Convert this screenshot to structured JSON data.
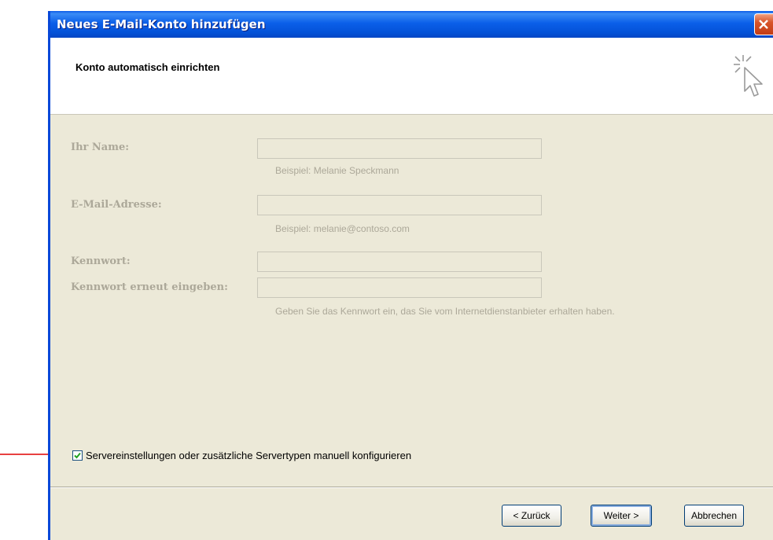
{
  "window": {
    "title": "Neues E-Mail-Konto hinzufügen"
  },
  "header": {
    "title": "Konto automatisch einrichten"
  },
  "form": {
    "name": {
      "label": "Ihr Name:",
      "value": "",
      "hint": "Beispiel: Melanie Speckmann"
    },
    "email": {
      "label": "E-Mail-Adresse:",
      "value": "",
      "hint": "Beispiel: melanie@contoso.com"
    },
    "password": {
      "label": "Kennwort:",
      "value": ""
    },
    "password_confirm": {
      "label": "Kennwort erneut eingeben:",
      "value": "",
      "hint": "Geben Sie das Kennwort ein, das Sie vom Internetdienstanbieter erhalten haben."
    }
  },
  "manual_config": {
    "label": "Servereinstellungen oder zusätzliche Servertypen manuell konfigurieren",
    "checked": true
  },
  "buttons": {
    "back": "< Zurück",
    "next": "Weiter >",
    "cancel": "Abbrechen"
  },
  "colors": {
    "titlebar": "#0452d8",
    "dialog_bg": "#ece9d8",
    "disabled_text": "#aca899",
    "annotation_arrow": "#e00000",
    "check": "#21a121"
  }
}
